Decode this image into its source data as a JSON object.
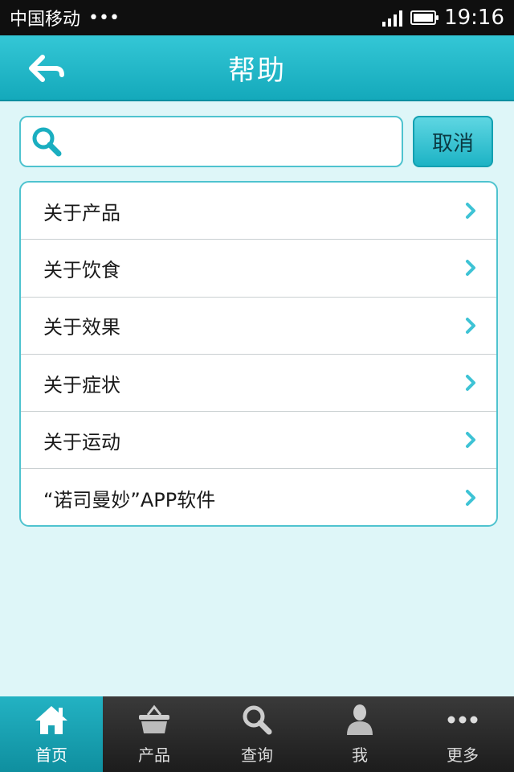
{
  "status_bar": {
    "carrier": "中国移动",
    "dots": "•••",
    "time": "19:16"
  },
  "header": {
    "title": "帮助",
    "back_icon": "back-arrow-icon"
  },
  "search": {
    "placeholder": "",
    "value": "",
    "icon": "search-icon",
    "cancel_label": "取消"
  },
  "menu": {
    "items": [
      {
        "label": "关于产品"
      },
      {
        "label": "关于饮食"
      },
      {
        "label": "关于效果"
      },
      {
        "label": "关于症状"
      },
      {
        "label": "关于运动"
      },
      {
        "label": "“诺司曼妙”APP软件"
      }
    ]
  },
  "tabs": [
    {
      "label": "首页",
      "icon": "home-icon",
      "active": true
    },
    {
      "label": "产品",
      "icon": "basket-icon",
      "active": false
    },
    {
      "label": "查询",
      "icon": "search-icon",
      "active": false
    },
    {
      "label": "我",
      "icon": "person-icon",
      "active": false
    },
    {
      "label": "更多",
      "icon": "more-icon",
      "active": false
    }
  ],
  "colors": {
    "accent": "#14a9bb",
    "background": "#def6f8",
    "chevron": "#3ec3d5"
  }
}
